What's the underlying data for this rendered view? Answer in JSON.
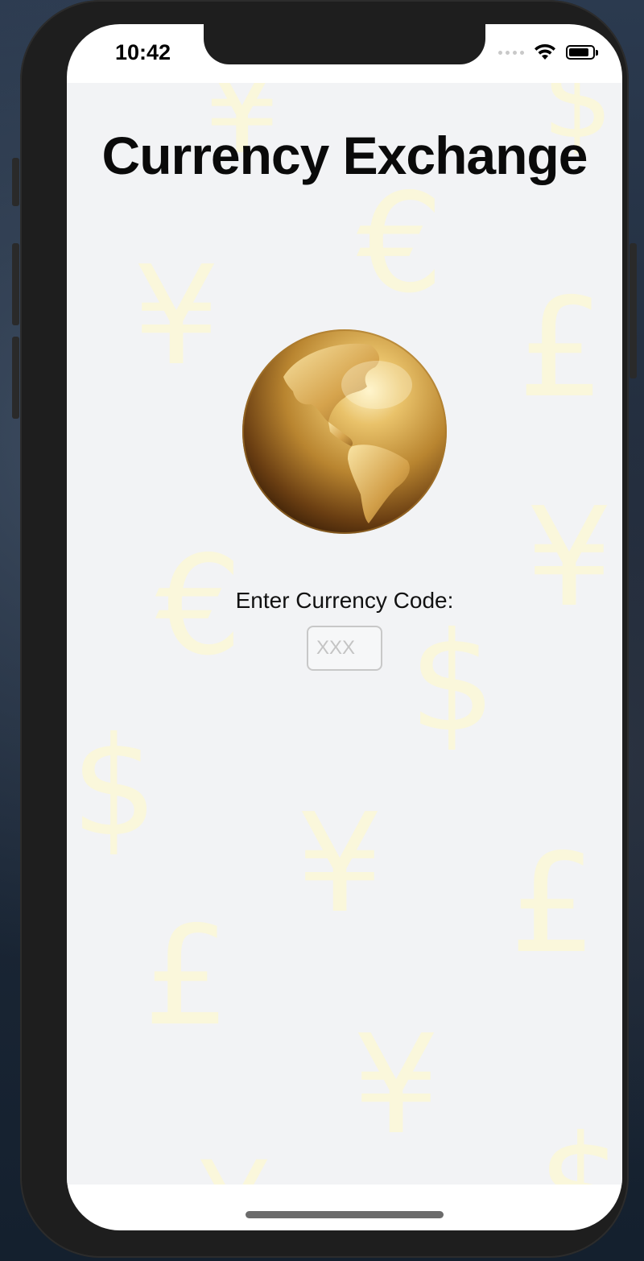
{
  "status_bar": {
    "time": "10:42",
    "icons": [
      "cellular-signal-icon",
      "wifi-icon",
      "battery-icon"
    ],
    "battery_level": 0.85
  },
  "page": {
    "title": "Currency Exchange",
    "logo": "gold-globe-icon",
    "background_symbols": [
      "¥",
      "€",
      "£",
      "$"
    ]
  },
  "currency_form": {
    "label": "Enter Currency Code:",
    "input_value": "",
    "input_placeholder": "XXX"
  },
  "colors": {
    "screen_background": "#f2f3f5",
    "symbol_tint": "#fcf7d6",
    "globe_gold": "#c9963c"
  }
}
